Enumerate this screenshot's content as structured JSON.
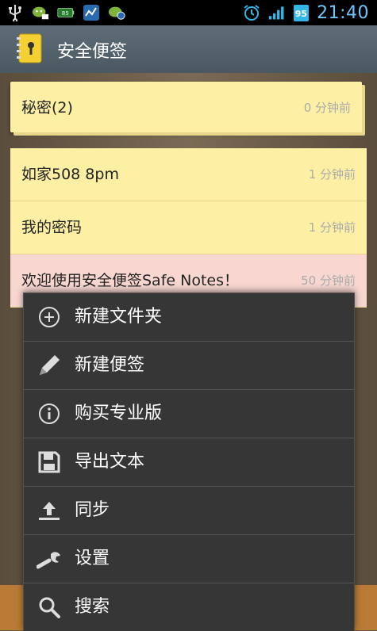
{
  "status_bar": {
    "time": "21:40",
    "battery": "95",
    "left_icons": [
      "usb-icon",
      "chat-icon",
      "battery-green-icon",
      "chart-icon",
      "chat-globe-icon"
    ],
    "right_icons": [
      "alarm-icon",
      "signal-icon"
    ]
  },
  "app": {
    "title": "安全便签"
  },
  "folder": {
    "title": "秘密(2)",
    "time": "0 分钟前"
  },
  "notes": [
    {
      "title": "如家508 8pm",
      "time": "1 分钟前",
      "color": "#fdf0a5"
    },
    {
      "title": "我的密码",
      "time": "1 分钟前",
      "color": "#fdf0a5"
    },
    {
      "title": "欢迎使用安全便签Safe Notes！",
      "time": "50 分钟前",
      "color": "#f8d7d1"
    }
  ],
  "menu": {
    "items": [
      {
        "label": "新建文件夹",
        "icon": "add-circle-icon"
      },
      {
        "label": "新建便签",
        "icon": "pencil-icon"
      },
      {
        "label": "购买专业版",
        "icon": "info-icon"
      },
      {
        "label": "导出文本",
        "icon": "save-icon"
      },
      {
        "label": "同步",
        "icon": "upload-icon"
      },
      {
        "label": "设置",
        "icon": "wrench-icon"
      },
      {
        "label": "搜索",
        "icon": "search-icon"
      }
    ]
  },
  "colors": {
    "action_bar": "#56646e",
    "note_yellow": "#fdf0a5",
    "note_pink": "#f8d7d1",
    "menu_bg": "#363636",
    "clock": "#6fc6ff"
  }
}
